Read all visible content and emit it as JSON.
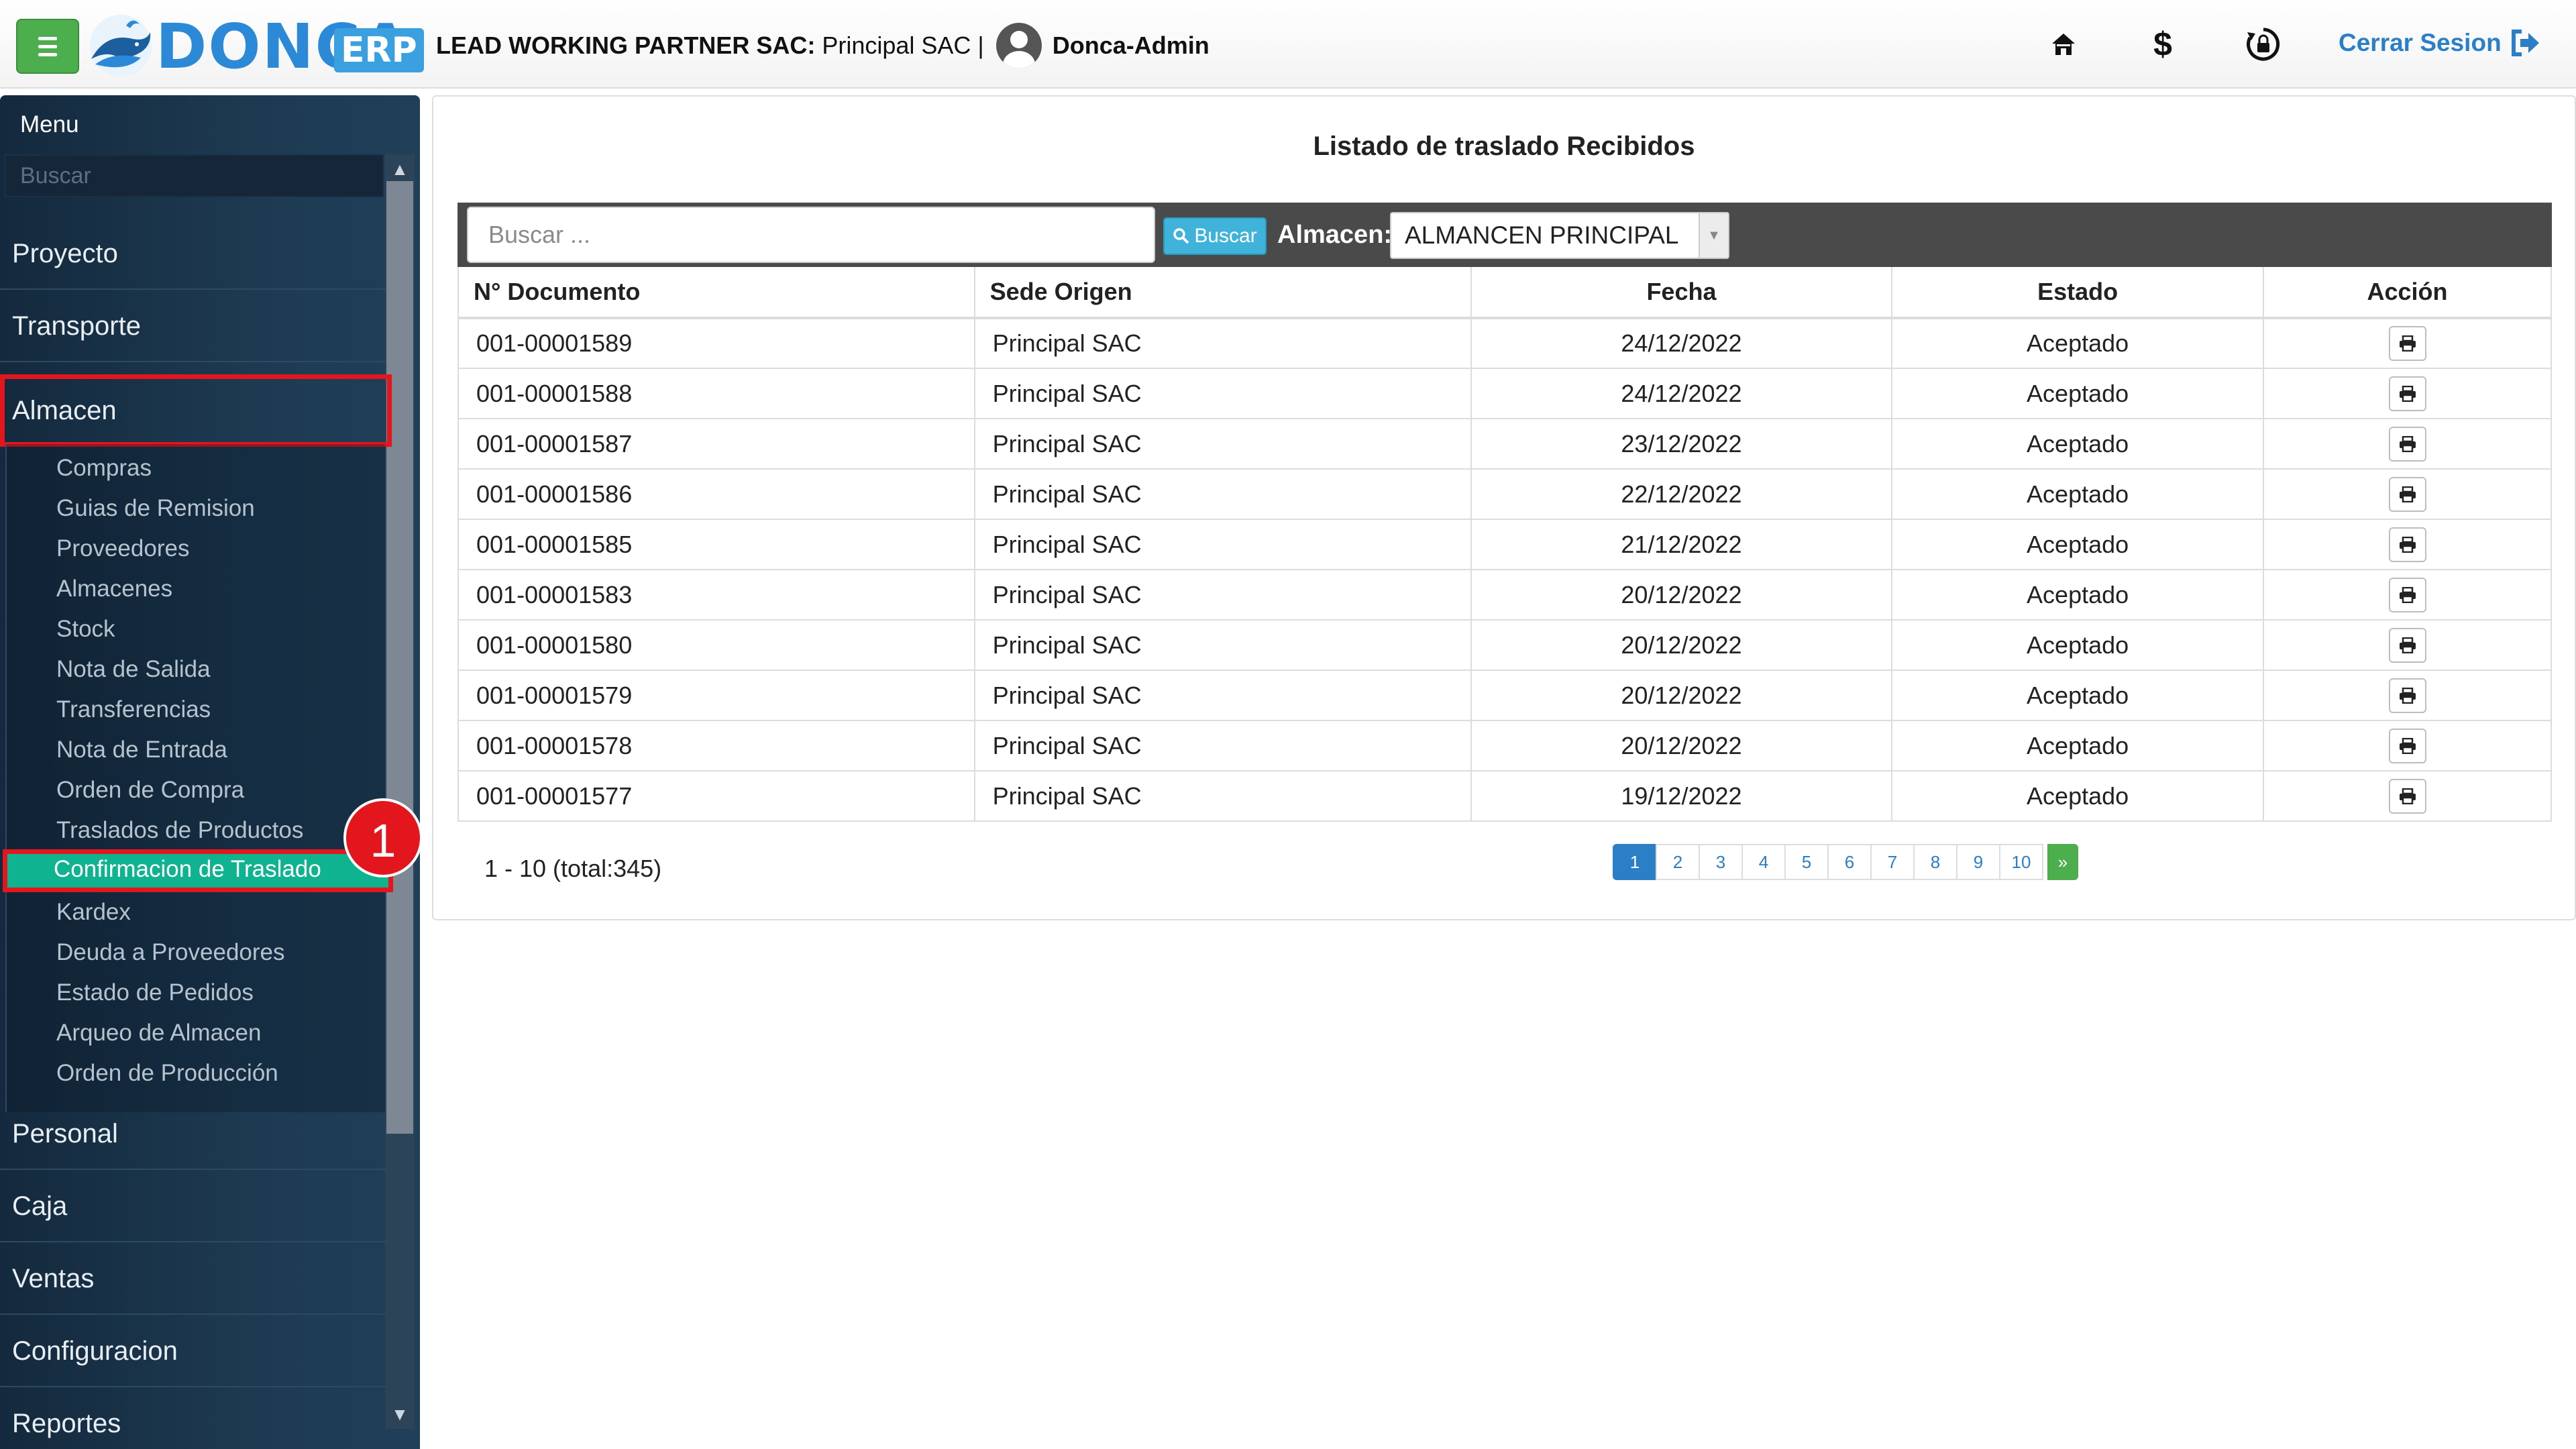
{
  "header": {
    "logo_text": "DONCA",
    "logo_badge": "ERP",
    "company_label": "LEAD WORKING PARTNER SAC:",
    "branch": " Principal SAC |",
    "user_name": "Donca-Admin",
    "logout_label": "Cerrar Sesion"
  },
  "sidebar": {
    "title": "Menu",
    "search_placeholder": "Buscar",
    "main_items": [
      "Proyecto",
      "Transporte",
      "Almacen",
      "Personal",
      "Caja",
      "Ventas",
      "Configuracion",
      "Reportes"
    ],
    "almacen_sub_items": [
      "Compras",
      "Guias de Remision",
      "Proveedores",
      "Almacenes",
      "Stock",
      "Nota de Salida",
      "Transferencias",
      "Nota de Entrada",
      "Orden de Compra",
      "Traslados de Productos",
      "Confirmacion de Traslado",
      "Kardex",
      "Deuda a Proveedores",
      "Estado de Pedidos",
      "Arqueo de Almacen",
      "Orden de Producción"
    ],
    "active_item": "Confirmacion de Traslado",
    "step_badge": "1"
  },
  "main": {
    "title": "Listado de traslado Recibidos",
    "search_placeholder": "Buscar ...",
    "search_button": "Buscar",
    "almacen_label": "Almacen:",
    "almacen_value": "ALMANCEN PRINCIPAL",
    "columns": [
      "N° Documento",
      "Sede Origen",
      "Fecha",
      "Estado",
      "Acción"
    ],
    "rows": [
      [
        "001-00001589",
        "Principal SAC",
        "24/12/2022",
        "Aceptado"
      ],
      [
        "001-00001588",
        "Principal SAC",
        "24/12/2022",
        "Aceptado"
      ],
      [
        "001-00001587",
        "Principal SAC",
        "23/12/2022",
        "Aceptado"
      ],
      [
        "001-00001586",
        "Principal SAC",
        "22/12/2022",
        "Aceptado"
      ],
      [
        "001-00001585",
        "Principal SAC",
        "21/12/2022",
        "Aceptado"
      ],
      [
        "001-00001583",
        "Principal SAC",
        "20/12/2022",
        "Aceptado"
      ],
      [
        "001-00001580",
        "Principal SAC",
        "20/12/2022",
        "Aceptado"
      ],
      [
        "001-00001579",
        "Principal SAC",
        "20/12/2022",
        "Aceptado"
      ],
      [
        "001-00001578",
        "Principal SAC",
        "20/12/2022",
        "Aceptado"
      ],
      [
        "001-00001577",
        "Principal SAC",
        "19/12/2022",
        "Aceptado"
      ]
    ],
    "pagination_info": "1 - 10 (total:345)",
    "pages": [
      "1",
      "2",
      "3",
      "4",
      "5",
      "6",
      "7",
      "8",
      "9",
      "10"
    ],
    "next_label": "»",
    "current_page": "1"
  },
  "colors": {
    "accent": "#2a7fc6",
    "active_menu": "#10b38f",
    "highlight_border": "#e3161e",
    "toggle_green": "#4cae4c"
  },
  "icons": [
    "menu-icon",
    "whale-logo-icon",
    "user-avatar-icon",
    "home-icon",
    "dollar-icon",
    "lock-refresh-icon",
    "sign-out-icon",
    "search-icon",
    "print-icon"
  ]
}
